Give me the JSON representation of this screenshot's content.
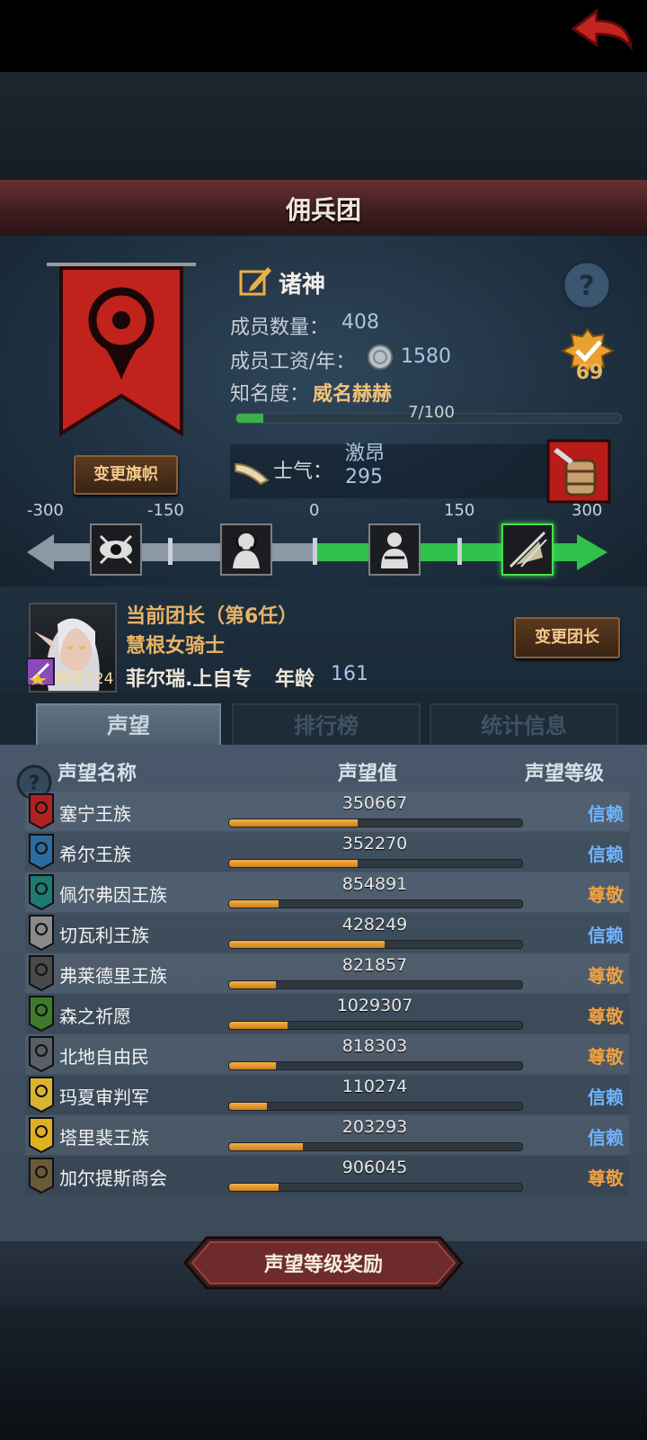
{
  "header": {
    "title": "佣兵团"
  },
  "guild": {
    "name": "诸神",
    "member_count_label": "成员数量：",
    "member_count": "408",
    "salary_label": "成员工资/年：",
    "salary": "1580",
    "fame_label": "知名度：",
    "fame_value": "威名赫赫",
    "fame_progress": "7/100",
    "fame_progress_fraction": 0.07,
    "badge_count": "69",
    "morale_label": "士气：",
    "morale_state": "激昂",
    "morale_value": "295",
    "change_banner_label": "变更旗帜"
  },
  "morale_scale": {
    "ticks": [
      "-300",
      "-150",
      "0",
      "150",
      "300"
    ],
    "icons": [
      "eye-icon",
      "despair-icon",
      "calm-icon",
      "victory-icon"
    ],
    "active_index": 3
  },
  "leader": {
    "title": "当前团长（第6任）",
    "class": "慧根女骑士",
    "name": "菲尔瑞.上自专",
    "age_label": "年龄",
    "age": "161",
    "level_label": "等级",
    "level": "124",
    "change_label": "变更团长"
  },
  "tabs": [
    {
      "label": "声望",
      "active": true
    },
    {
      "label": "排行榜",
      "active": false
    },
    {
      "label": "统计信息",
      "active": false
    }
  ],
  "reputation": {
    "columns": [
      "声望名称",
      "声望值",
      "声望等级"
    ],
    "rows": [
      {
        "name": "塞宁王族",
        "value": "350667",
        "fill": 0.44,
        "level": "信赖",
        "level_color": "#6fb4ff",
        "icon_color": "#b02222"
      },
      {
        "name": "希尔王族",
        "value": "352270",
        "fill": 0.44,
        "level": "信赖",
        "level_color": "#6fb4ff",
        "icon_color": "#2d6a9e"
      },
      {
        "name": "佩尔弗因王族",
        "value": "854891",
        "fill": 0.17,
        "level": "尊敬",
        "level_color": "#f0a040",
        "icon_color": "#1c7a70"
      },
      {
        "name": "切瓦利王族",
        "value": "428249",
        "fill": 0.53,
        "level": "信赖",
        "level_color": "#6fb4ff",
        "icon_color": "#8a8a8a"
      },
      {
        "name": "弗莱德里王族",
        "value": "821857",
        "fill": 0.16,
        "level": "尊敬",
        "level_color": "#f0a040",
        "icon_color": "#4a4a4a"
      },
      {
        "name": "森之祈愿",
        "value": "1029307",
        "fill": 0.2,
        "level": "尊敬",
        "level_color": "#f0a040",
        "icon_color": "#3f7a2c"
      },
      {
        "name": "北地自由民",
        "value": "818303",
        "fill": 0.16,
        "level": "尊敬",
        "level_color": "#f0a040",
        "icon_color": "#5a5e66"
      },
      {
        "name": "玛夏审判军",
        "value": "110274",
        "fill": 0.13,
        "level": "信赖",
        "level_color": "#6fb4ff",
        "icon_color": "#d8b430"
      },
      {
        "name": "塔里裴王族",
        "value": "203293",
        "fill": 0.25,
        "level": "信赖",
        "level_color": "#6fb4ff",
        "icon_color": "#e0b020"
      },
      {
        "name": "加尔提斯商会",
        "value": "906045",
        "fill": 0.17,
        "level": "尊敬",
        "level_color": "#f0a040",
        "icon_color": "#6b5a3a"
      }
    ]
  },
  "reward_button": {
    "label": "声望等级奖励"
  },
  "colors": {
    "accent_red": "#c0221c",
    "morale_green": "#2fc24a",
    "morale_gray": "#8c98a6",
    "rep_blue": "#6fb4ff",
    "rep_orange": "#f0a040"
  }
}
